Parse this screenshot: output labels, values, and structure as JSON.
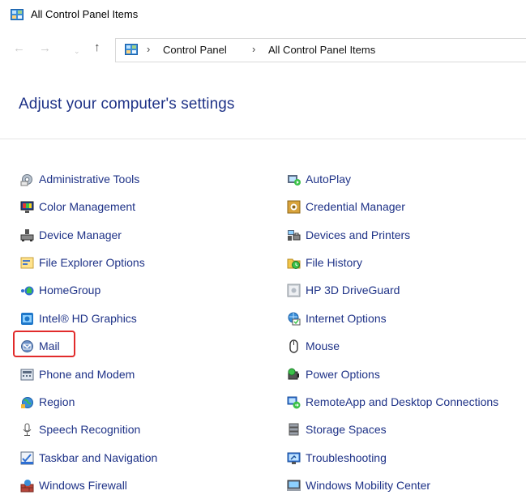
{
  "window": {
    "title": "All Control Panel Items"
  },
  "nav": {
    "back": "←",
    "forward": "→",
    "dropdown": "⌄",
    "up": "↑",
    "breadcrumb": [
      "Control Panel",
      "All Control Panel Items"
    ],
    "separator": "›"
  },
  "heading": "Adjust your computer's settings",
  "items": {
    "administrative_tools": "Administrative Tools",
    "autoplay": "AutoPlay",
    "color_management": "Color Management",
    "credential_manager": "Credential Manager",
    "device_manager": "Device Manager",
    "devices_and_printers": "Devices and Printers",
    "file_explorer_options": "File Explorer Options",
    "file_history": "File History",
    "homegroup": "HomeGroup",
    "hp_3d_driveguard": "HP 3D DriveGuard",
    "intel_hd_graphics": "Intel® HD Graphics",
    "internet_options": "Internet Options",
    "mail": "Mail",
    "mouse": "Mouse",
    "phone_and_modem": "Phone and Modem",
    "power_options": "Power Options",
    "region": "Region",
    "remoteapp": "RemoteApp and Desktop Connections",
    "speech_recognition": "Speech Recognition",
    "storage_spaces": "Storage Spaces",
    "taskbar_and_navigation": "Taskbar and Navigation",
    "troubleshooting": "Troubleshooting",
    "windows_firewall": "Windows Firewall",
    "windows_mobility_center": "Windows Mobility Center"
  },
  "colors": {
    "link": "#1e3287",
    "highlight": "#e12b2b"
  }
}
